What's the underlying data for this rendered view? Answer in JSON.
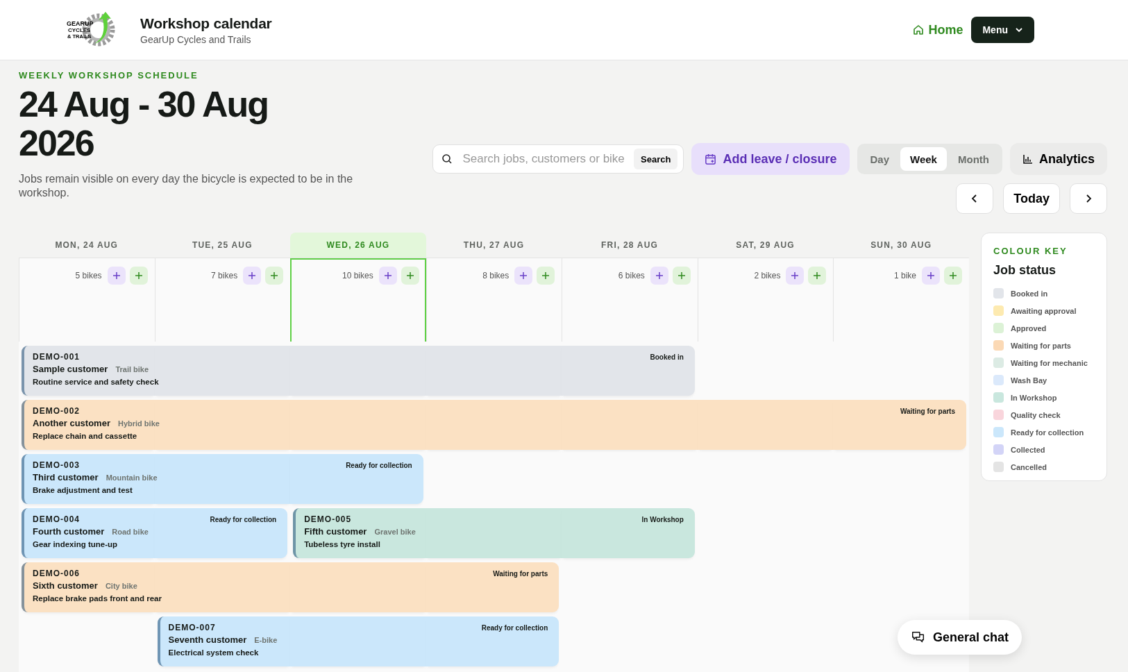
{
  "header": {
    "logo_text": [
      "GEARUP",
      "CYCLES",
      "& TRAILS"
    ],
    "title": "Workshop calendar",
    "subtitle": "GearUp Cycles and Trails",
    "home": "Home",
    "menu": "Menu"
  },
  "intro": {
    "eyebrow": "WEEKLY WORKSHOP SCHEDULE",
    "title_lines": [
      "24 Aug - 30 Aug",
      "2026"
    ],
    "description": "Jobs remain visible on every day the bicycle is expected to be in the workshop."
  },
  "toolbar": {
    "search": {
      "placeholder": "Search jobs, customers or bike",
      "button": "Search"
    },
    "add_leave": "Add leave / closure",
    "views": [
      {
        "label": "Day",
        "selected": false
      },
      {
        "label": "Week",
        "selected": true
      },
      {
        "label": "Month",
        "selected": false
      }
    ],
    "analytics": "Analytics",
    "today": "Today"
  },
  "days": [
    {
      "label": "MON, 24 AUG",
      "count": "5 bikes",
      "today": false
    },
    {
      "label": "TUE, 25 AUG",
      "count": "7 bikes",
      "today": false
    },
    {
      "label": "WED, 26 AUG",
      "count": "10 bikes",
      "today": true
    },
    {
      "label": "THU, 27 AUG",
      "count": "8 bikes",
      "today": false
    },
    {
      "label": "FRI, 28 AUG",
      "count": "6 bikes",
      "today": false
    },
    {
      "label": "SAT, 29 AUG",
      "count": "2 bikes",
      "today": false
    },
    {
      "label": "SUN, 30 AUG",
      "count": "1 bike",
      "today": false
    }
  ],
  "lanes": [
    [
      {
        "id": "DEMO-001",
        "customer": "Sample customer",
        "bike": "Trail bike",
        "task": "Routine service and safety check",
        "status": "Booked in",
        "color": "#e2e5ea",
        "on_days": [
          true,
          true,
          true,
          true,
          true,
          false,
          false
        ]
      }
    ],
    [
      {
        "id": "DEMO-002",
        "customer": "Another customer",
        "bike": "Hybrid bike",
        "task": "Replace chain and cassette",
        "status": "Waiting for parts",
        "color": "#fbe1c3",
        "on_days": [
          true,
          true,
          true,
          true,
          true,
          true,
          true
        ]
      }
    ],
    [
      {
        "id": "DEMO-003",
        "customer": "Third customer",
        "bike": "Mountain bike",
        "task": "Brake adjustment and test",
        "status": "Ready for collection",
        "color": "#cbe7fb",
        "on_days": [
          true,
          true,
          true,
          false,
          false,
          false,
          false
        ]
      }
    ],
    [
      {
        "id": "DEMO-004",
        "customer": "Fourth customer",
        "bike": "Road bike",
        "task": "Gear indexing tune-up",
        "status": "Ready for collection",
        "color": "#cbe7fb",
        "on_days": [
          true,
          true,
          false,
          false,
          false,
          false,
          false
        ]
      },
      {
        "id": "DEMO-005",
        "customer": "Fifth customer",
        "bike": "Gravel bike",
        "task": "Tubeless tyre install",
        "status": "In Workshop",
        "color": "#c9e7de",
        "on_days": [
          false,
          false,
          true,
          true,
          true,
          false,
          false
        ]
      }
    ],
    [
      {
        "id": "DEMO-006",
        "customer": "Sixth customer",
        "bike": "City bike",
        "task": "Replace brake pads front and rear",
        "status": "Waiting for parts",
        "color": "#fbe1c3",
        "on_days": [
          true,
          true,
          true,
          true,
          false,
          false,
          false
        ]
      }
    ],
    [
      {
        "id": "DEMO-007",
        "customer": "Seventh customer",
        "bike": "E-bike",
        "task": "Electrical system check",
        "status": "Ready for collection",
        "color": "#cbe7fb",
        "on_days": [
          false,
          true,
          true,
          true,
          false,
          false,
          false
        ]
      }
    ]
  ],
  "legend": {
    "eyebrow": "COLOUR KEY",
    "title": "Job status",
    "items": [
      {
        "label": "Booked in",
        "color": "#e2e5ea"
      },
      {
        "label": "Awaiting approval",
        "color": "#fdeab0"
      },
      {
        "label": "Approved",
        "color": "#dcf2d6"
      },
      {
        "label": "Waiting for parts",
        "color": "#fbd9b5"
      },
      {
        "label": "Waiting for mechanic",
        "color": "#dcebe4"
      },
      {
        "label": "Wash Bay",
        "color": "#dbe9fb"
      },
      {
        "label": "In Workshop",
        "color": "#c9e7de"
      },
      {
        "label": "Quality check",
        "color": "#f9d5dc"
      },
      {
        "label": "Ready for collection",
        "color": "#cbe7fb"
      },
      {
        "label": "Collected",
        "color": "#d3d4f7"
      },
      {
        "label": "Cancelled",
        "color": "#e4e4e4"
      }
    ]
  },
  "chat": "General chat"
}
